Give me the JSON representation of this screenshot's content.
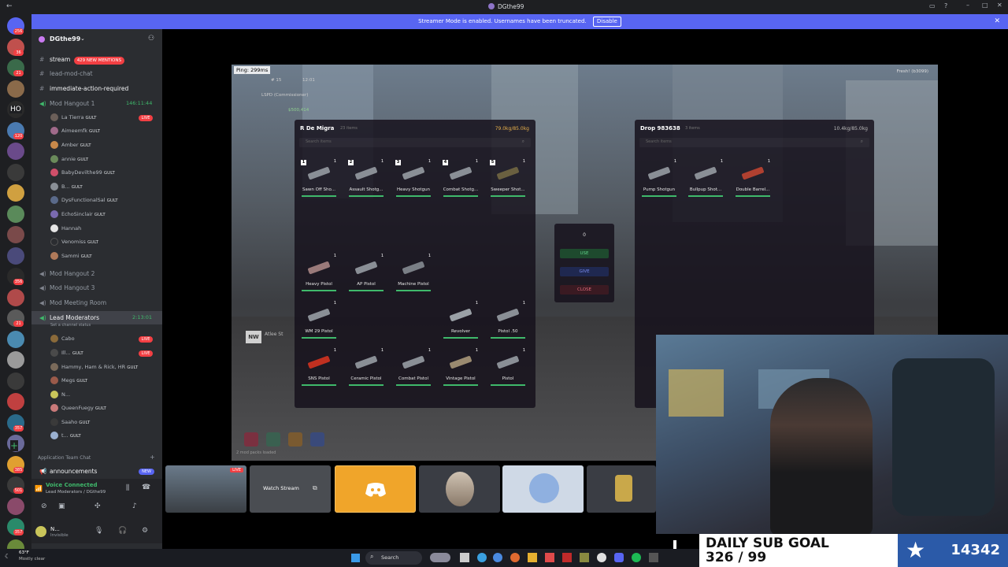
{
  "window": {
    "title": "DGthe99"
  },
  "streamer_banner": {
    "text": "Streamer Mode is enabled. Usernames have been truncated.",
    "button": "Disable"
  },
  "rail": {
    "badges": [
      "256",
      "36",
      "21",
      "",
      "",
      "120",
      "",
      "",
      "",
      "",
      "",
      "",
      "356",
      "",
      "21",
      "",
      "",
      "",
      "",
      "357",
      "",
      "385",
      "501",
      "",
      "357",
      "429"
    ],
    "home_label": "HO"
  },
  "server": {
    "name": "DGthe99"
  },
  "channels": [
    {
      "name": "stream",
      "mentions": "429 NEW MENTIONS"
    },
    {
      "name": "lead-mod-chat"
    },
    {
      "name": "immediate-action-required"
    }
  ],
  "voice_channels": [
    {
      "name": "Mod Hangout 1",
      "time": "146:11:44"
    },
    {
      "name": "Mod Hangout 2"
    },
    {
      "name": "Mod Hangout 3"
    },
    {
      "name": "Mod Meeting Room"
    },
    {
      "name": "Lead Moderators",
      "time": "2:13:01",
      "status": "Set a channel status"
    }
  ],
  "hangout1_users": [
    {
      "name": "La Tierra",
      "tag": "GULT",
      "live": "LIVE"
    },
    {
      "name": "Aimeemfk",
      "tag": "GULT"
    },
    {
      "name": "Amber",
      "tag": "GULT"
    },
    {
      "name": "annie",
      "tag": "GULT"
    },
    {
      "name": "BabyDevilthe99",
      "tag": "GULT"
    },
    {
      "name": "B...",
      "tag": "GULT"
    },
    {
      "name": "DysFunctionalSal",
      "tag": "GULT"
    },
    {
      "name": "EchoSinclair",
      "tag": "GULT"
    },
    {
      "name": "Hannah"
    },
    {
      "name": "Venomiss",
      "tag": "GULT"
    },
    {
      "name": "Sammi",
      "tag": "GULT"
    }
  ],
  "lead_users": [
    {
      "name": "Cabo",
      "live": "LIVE"
    },
    {
      "name": "Ill...",
      "tag": "GULT",
      "live": "LIVE"
    },
    {
      "name": "Hammy, Ham & Rick, HR",
      "tag": "GULT"
    },
    {
      "name": "Megs",
      "tag": "GULT"
    },
    {
      "name": "N..."
    },
    {
      "name": "QueenFuegy",
      "tag": "GULT"
    },
    {
      "name": "Saaho",
      "tag": "GULT"
    },
    {
      "name": "t...",
      "tag": "GULT"
    }
  ],
  "category": {
    "name": "Application Team Chat"
  },
  "announcements": {
    "name": "announcements",
    "badge": "NEW"
  },
  "voice": {
    "status": "Voice Connected",
    "channel": "Lead Moderators / DGthe99"
  },
  "user": {
    "name": "N...",
    "status": "Invisible"
  },
  "weather": {
    "temp": "63°F",
    "desc": "Mostly clear"
  },
  "game": {
    "ping": "Ping: 299ms",
    "top_right": "Fresh! (b3099)",
    "hud_left": [
      "# 15",
      "12:01",
      "LSPD (Commissioner)",
      "$500,414"
    ],
    "bottom_left": "2 mod packs loaded",
    "player_tag": "NW",
    "player_name": "Atlee St",
    "left_inv": {
      "title": "R De Migra",
      "subtitle": "23 items",
      "weight": "79.0kg/85.0kg",
      "search": "Search items",
      "slots": [
        {
          "num": "1",
          "cnt": "1",
          "name": "Sawn Off Sho..."
        },
        {
          "num": "2",
          "cnt": "1",
          "name": "Assault Shotg..."
        },
        {
          "num": "3",
          "cnt": "1",
          "name": "Heavy Shotgun"
        },
        {
          "num": "4",
          "cnt": "1",
          "name": "Combat Shotg..."
        },
        {
          "num": "5",
          "cnt": "1",
          "name": "Sweeper Shot..."
        },
        {
          "cnt": "1",
          "name": "Heavy Pistol"
        },
        {
          "cnt": "1",
          "name": "AP Pistol"
        },
        {
          "cnt": "1",
          "name": "Machine Pistol"
        },
        {
          "cnt": "1",
          "name": "WM 29 Pistol"
        },
        {
          "cnt": "1",
          "name": "Revolver"
        },
        {
          "cnt": "1",
          "name": "Pistol .50"
        },
        {
          "cnt": "1",
          "name": "SNS Pistol"
        },
        {
          "cnt": "1",
          "name": "Ceramic Pistol"
        },
        {
          "cnt": "1",
          "name": "Combat Pistol"
        },
        {
          "cnt": "1",
          "name": "Vintage Pistol"
        },
        {
          "cnt": "1",
          "name": "Pistol"
        }
      ]
    },
    "right_inv": {
      "title": "Drop 983638",
      "subtitle": "3 items",
      "weight": "10.4kg/85.0kg",
      "search": "Search items",
      "slots": [
        {
          "cnt": "1",
          "name": "Pump Shotgun"
        },
        {
          "cnt": "1",
          "name": "Bullpup Shot..."
        },
        {
          "cnt": "1",
          "name": "Double Barrel..."
        }
      ]
    },
    "actions": {
      "amount": "0",
      "use": "USE",
      "give": "GIVE",
      "close": "CLOSE"
    }
  },
  "streams": {
    "watch": "Watch Stream",
    "live": "LIVE"
  },
  "overlay": {
    "sub_goal_title": "DAILY SUB GOAL",
    "sub_goal_value": "326 / 99",
    "sub_count": "14342"
  },
  "taskbar": {
    "search": "Search"
  },
  "colors": {
    "accent": "#5865f2",
    "live": "#f23f43",
    "green": "#3fb96b",
    "discord_yellow": "#f0a52a"
  }
}
